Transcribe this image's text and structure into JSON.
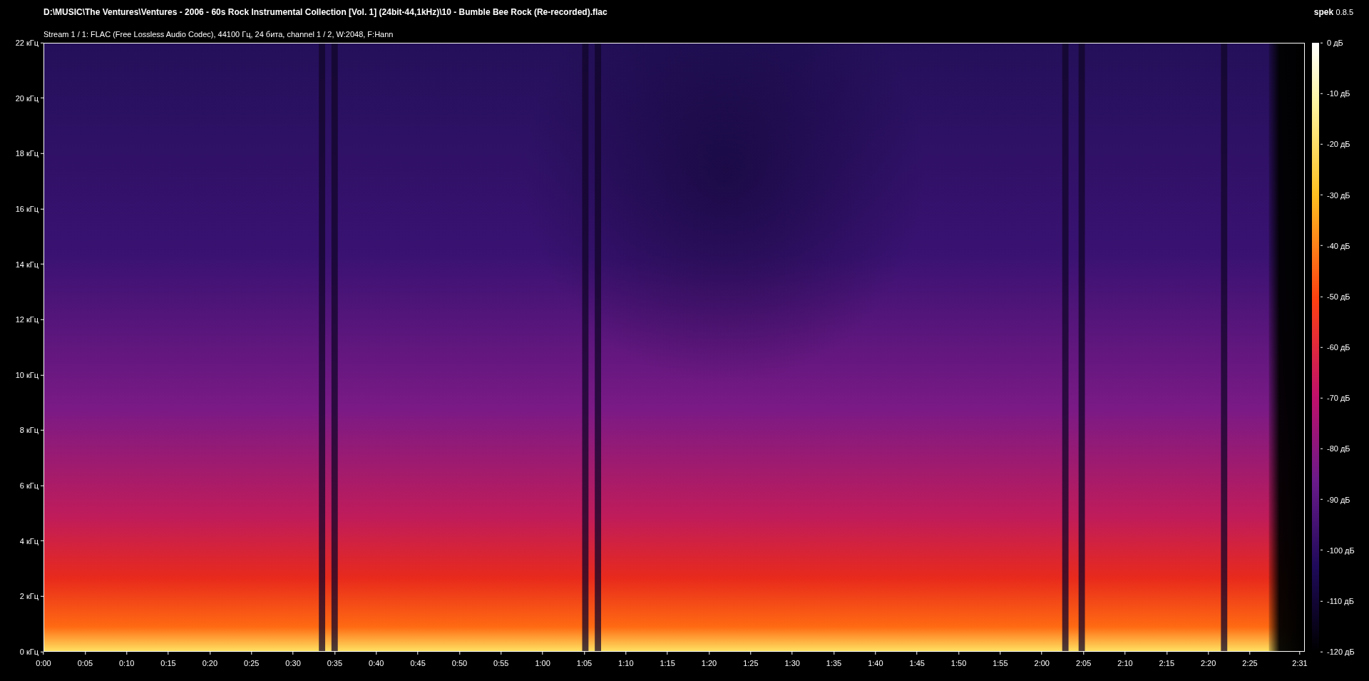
{
  "window": {
    "title": "D:\\MUSIC\\The Ventures\\Ventures - 2006 - 60s Rock Instrumental Collection [Vol. 1] (24bit-44,1kHz)\\10 - Bumble Bee Rock (Re-recorded).flac",
    "subtitle": "Stream 1 / 1: FLAC (Free Lossless Audio Codec), 44100 Гц, 24 бита, channel 1 / 2, W:2048, F:Hann"
  },
  "app": {
    "name": "spek",
    "version": "0.8.5"
  },
  "frequency_axis": [
    "22 кГц",
    "20 кГц",
    "18 кГц",
    "16 кГц",
    "14 кГц",
    "12 кГц",
    "10 кГц",
    "8 кГц",
    "6 кГц",
    "4 кГц",
    "2 кГц",
    "0 кГц"
  ],
  "time_axis": [
    "0:00",
    "0:05",
    "0:10",
    "0:15",
    "0:20",
    "0:25",
    "0:30",
    "0:35",
    "0:40",
    "0:45",
    "0:50",
    "0:55",
    "1:00",
    "1:05",
    "1:10",
    "1:15",
    "1:20",
    "1:25",
    "1:30",
    "1:35",
    "1:40",
    "1:45",
    "1:50",
    "1:55",
    "2:00",
    "2:05",
    "2:10",
    "2:15",
    "2:20",
    "2:25",
    "2:31"
  ],
  "color_scale": [
    "0 дБ",
    "-10 дБ",
    "-20 дБ",
    "-30 дБ",
    "-40 дБ",
    "-50 дБ",
    "-60 дБ",
    "-70 дБ",
    "-80 дБ",
    "-90 дБ",
    "-100 дБ",
    "-110 дБ",
    "-120 дБ"
  ]
}
